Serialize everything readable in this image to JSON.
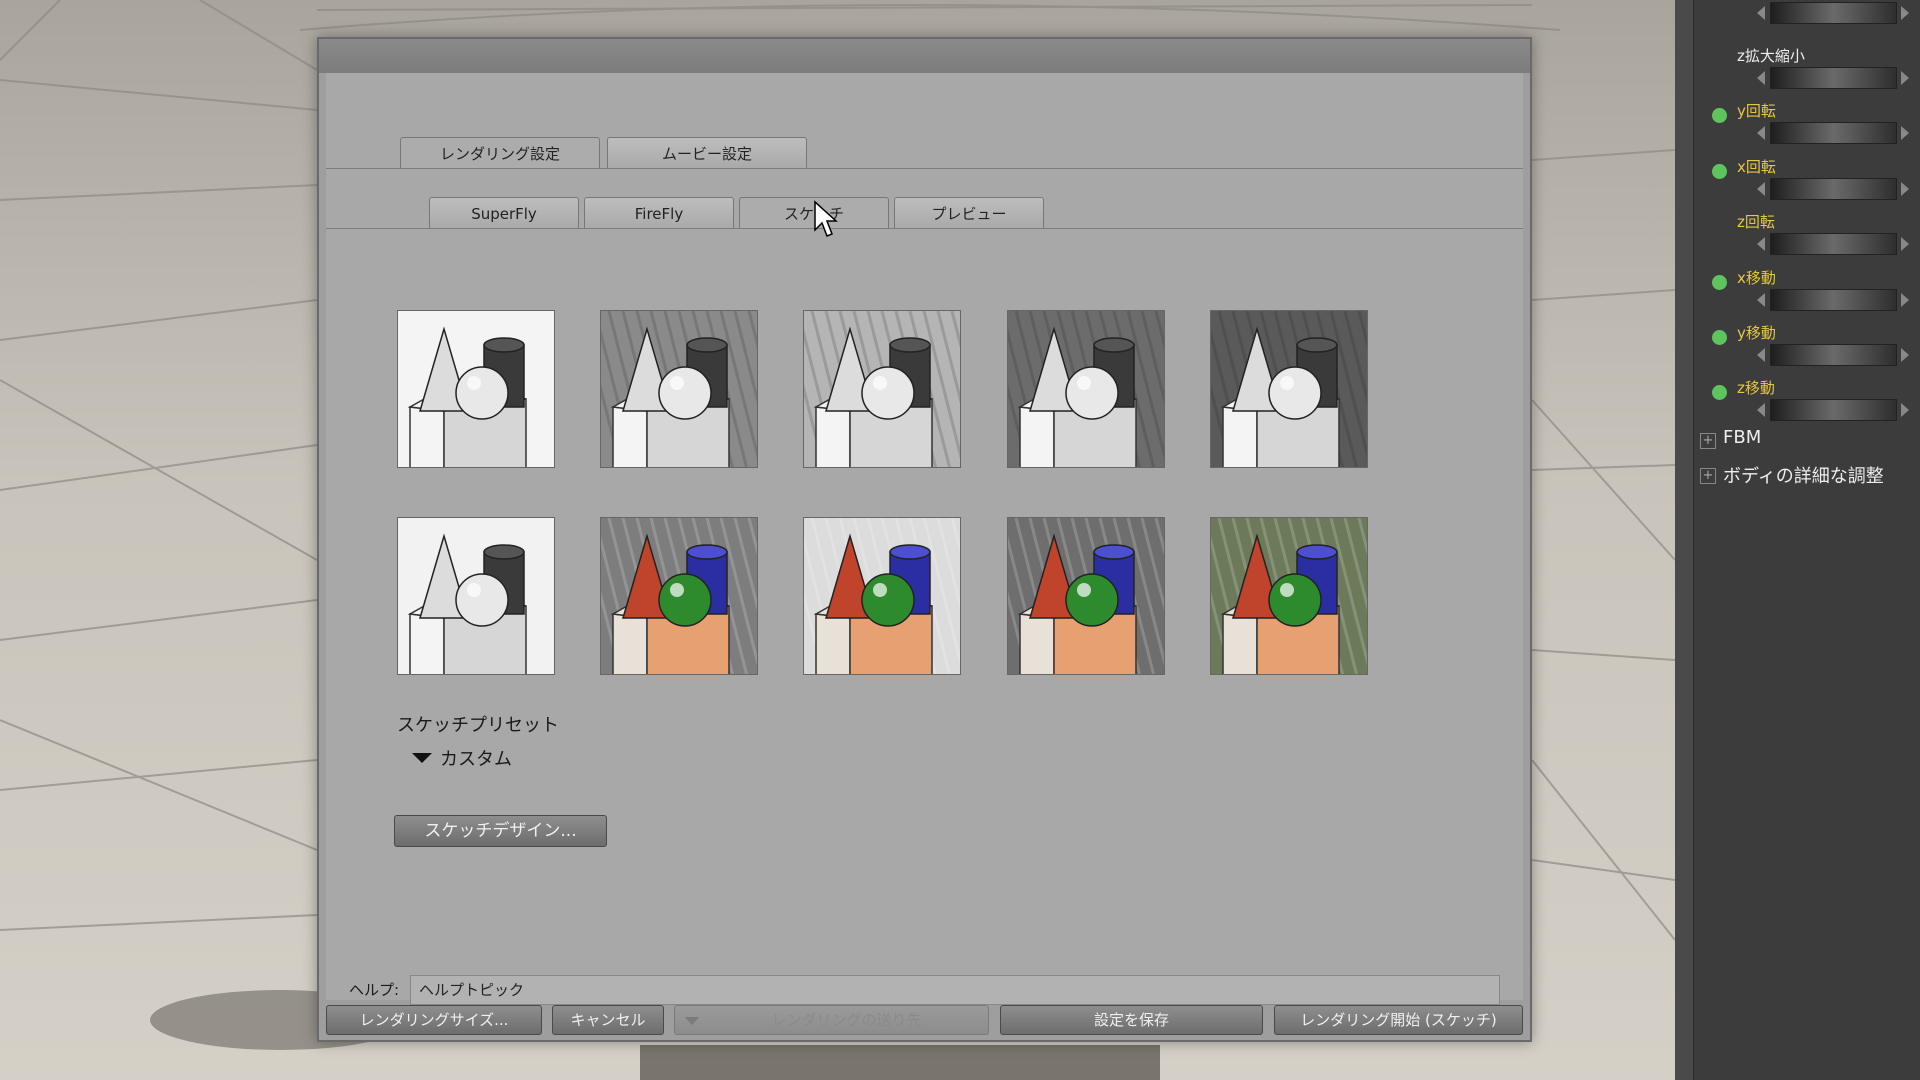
{
  "dialog": {
    "main_tabs": [
      {
        "label": "レンダリング設定",
        "active": true
      },
      {
        "label": "ムービー設定",
        "active": false
      }
    ],
    "engine_tabs": [
      {
        "label": "SuperFly",
        "active": false
      },
      {
        "label": "FireFly",
        "active": false
      },
      {
        "label": "スケッチ",
        "active": true
      },
      {
        "label": "プレビュー",
        "active": false
      }
    ],
    "preset_label": "スケッチプリセット",
    "preset_value": "カスタム",
    "sketch_design_button": "スケッチデザイン...",
    "help_label": "ヘルプ:",
    "help_value": "ヘルプトピック",
    "footer": {
      "render_size": "レンダリングサイズ...",
      "cancel": "キャンセル",
      "render_destination": "レンダリングの送り先",
      "save_settings": "設定を保存",
      "start_render": "レンダリング開始 (スケッチ)"
    },
    "thumbnail_styles": [
      "bw-light",
      "bw-hatch",
      "bw-swirl",
      "bw-fur",
      "bw-dark",
      "bw-pencil",
      "color-dark",
      "color-pastel",
      "color-fur",
      "color-noise"
    ]
  },
  "params": {
    "z_scale": "z拡大縮小",
    "y_rotate": "y回転",
    "x_rotate": "x回転",
    "z_rotate": "z回転",
    "x_move": "x移動",
    "y_move": "y移動",
    "z_move": "z移動",
    "fbm": "FBM",
    "body_detail": "ボディの詳細な調整"
  },
  "colors": {
    "param_dot": "#5ec45e",
    "param_label": "#e6c83e"
  }
}
